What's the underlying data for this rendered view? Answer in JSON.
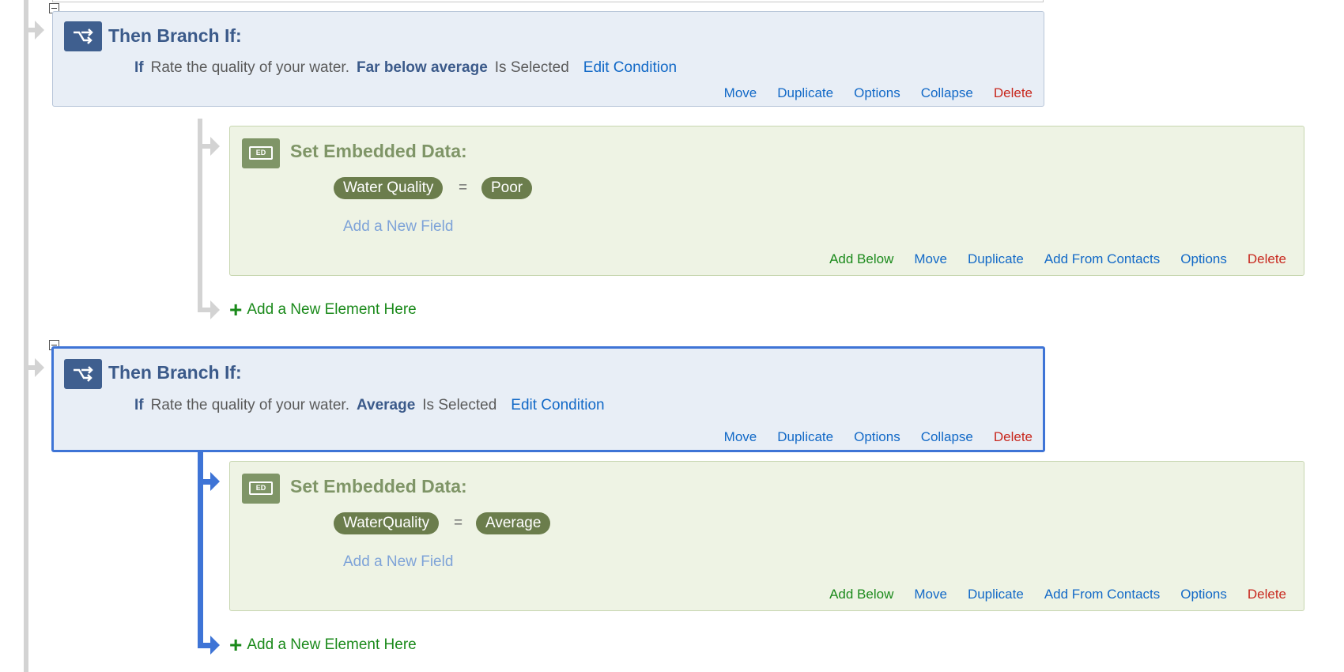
{
  "branches": [
    {
      "title": "Then Branch If:",
      "condition": {
        "keyword": "If",
        "question": "Rate the quality of your water.",
        "choice": "Far below average",
        "operator": "Is Selected",
        "edit_label": "Edit Condition"
      },
      "actions": {
        "move": "Move",
        "duplicate": "Duplicate",
        "options": "Options",
        "collapse": "Collapse",
        "delete": "Delete"
      },
      "embedded": {
        "icon_text": "ED",
        "title": "Set Embedded Data:",
        "field": "Water Quality",
        "equals": "=",
        "value": "Poor",
        "add_field": "Add a New Field",
        "actions": {
          "add_below": "Add Below",
          "move": "Move",
          "duplicate": "Duplicate",
          "add_from_contacts": "Add From Contacts",
          "options": "Options",
          "delete": "Delete"
        }
      },
      "add_element": "Add a New Element Here"
    },
    {
      "title": "Then Branch If:",
      "condition": {
        "keyword": "If",
        "question": "Rate the quality of your water.",
        "choice": "Average",
        "operator": "Is Selected",
        "edit_label": "Edit Condition"
      },
      "actions": {
        "move": "Move",
        "duplicate": "Duplicate",
        "options": "Options",
        "collapse": "Collapse",
        "delete": "Delete"
      },
      "embedded": {
        "icon_text": "ED",
        "title": "Set Embedded Data:",
        "field": "WaterQuality",
        "equals": "=",
        "value": "Average",
        "add_field": "Add a New Field",
        "actions": {
          "add_below": "Add Below",
          "move": "Move",
          "duplicate": "Duplicate",
          "add_from_contacts": "Add From Contacts",
          "options": "Options",
          "delete": "Delete"
        }
      },
      "add_element": "Add a New Element Here"
    }
  ],
  "colors": {
    "branch_bg": "#e8eef6",
    "branch_title": "#3b5a8a",
    "selected_border": "#3e74d6",
    "embedded_bg": "#eef3e4",
    "embedded_title": "#7f9567",
    "pill_bg": "#6b7d4c",
    "link_blue": "#1269c7",
    "delete_red": "#c8281e",
    "add_green": "#1b8a1b"
  }
}
